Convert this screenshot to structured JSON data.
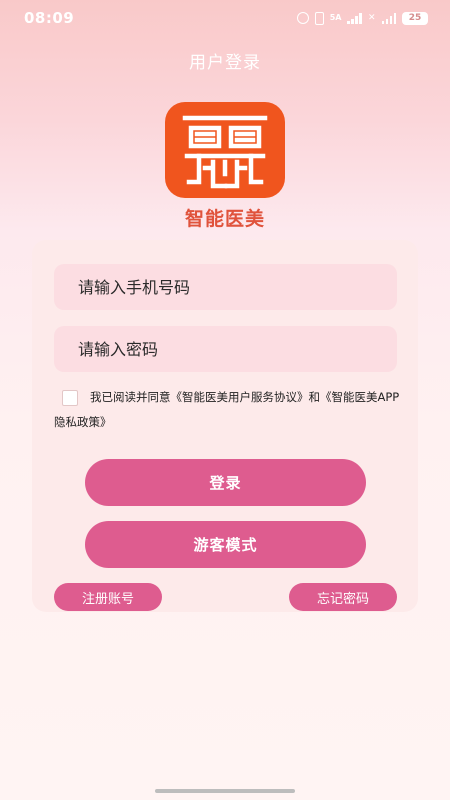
{
  "status_bar": {
    "time": "08:09",
    "network": "5A",
    "battery": "25",
    "icons": [
      "alarm-icon",
      "vibrate-icon",
      "signal-icon",
      "wifi-off-icon",
      "signal-icon",
      "battery-icon"
    ]
  },
  "header": {
    "title": "用户登录"
  },
  "app": {
    "name": "智能医美",
    "logo_icon": "app-logo-icon",
    "logo_color": "#f0551e"
  },
  "form": {
    "phone_placeholder": "请输入手机号码",
    "password_placeholder": "请输入密码",
    "agreement": {
      "prefix": "我已阅读并同意",
      "user_agreement": "《智能医美用户服务协议》",
      "conjunction": "和",
      "privacy_policy": "《智能医美APP隐私政策》"
    },
    "login_label": "登录",
    "guest_label": "游客模式",
    "register_label": "注册账号",
    "forgot_label": "忘记密码"
  },
  "colors": {
    "accent": "#de5c8f",
    "input_bg": "#fcdde2",
    "card_bg": "#fdeaea",
    "logo_orange": "#f0551e",
    "app_name": "#e0533c"
  }
}
